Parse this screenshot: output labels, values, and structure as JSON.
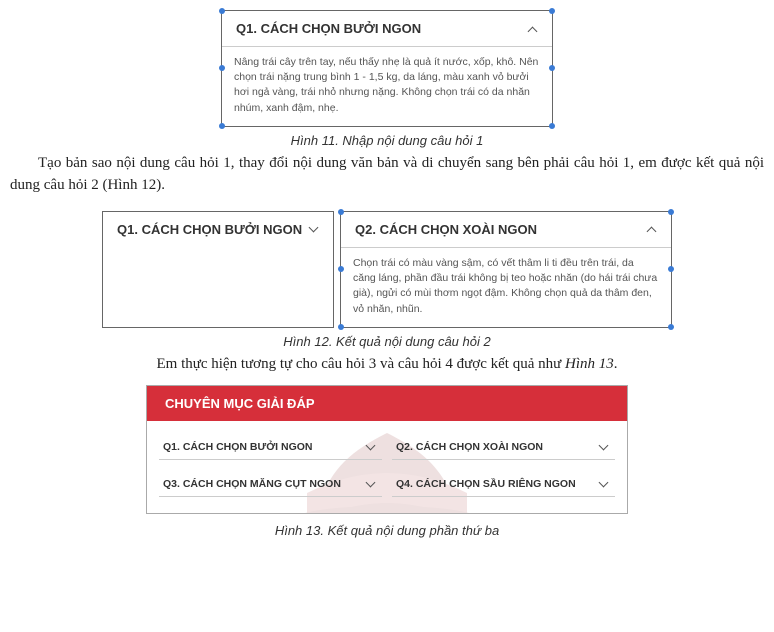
{
  "fig11": {
    "title": "Q1. CÁCH CHỌN BƯỞI NGON",
    "body": "Nâng trái cây trên tay, nếu thấy nhẹ là quả ít nước, xốp, khô. Nên chọn trái nặng trung bình 1 - 1,5 kg, da láng, màu xanh vỏ bưởi hơi ngả vàng, trái nhỏ nhưng nặng. Không chọn trái có da nhăn nhúm, xanh đậm, nhẹ.",
    "caption": "Hình 11. Nhập nội dung câu hỏi 1"
  },
  "para1": "Tạo bản sao nội dung câu hỏi 1, thay đổi nội dung văn bản và di chuyển sang bên phải câu hỏi 1, em được kết quả nội dung câu hỏi 2 (Hình 12).",
  "fig12": {
    "left_title": "Q1. CÁCH CHỌN BƯỞI NGON",
    "right_title": "Q2. CÁCH CHỌN XOÀI NGON",
    "right_body": "Chọn trái có màu vàng sậm, có vết thâm li ti đều trên trái, da căng láng, phần đầu trái không bị teo hoặc nhăn (do hái trái chưa già), ngửi có mùi thơm ngọt đậm. Không chọn quả da thâm đen, vỏ nhăn, nhũn.",
    "caption": "Hình 12. Kết quả nội dung câu hỏi 2"
  },
  "para2_a": "Em thực hiện tương tự cho câu hỏi 3 và câu hỏi 4 được kết quả như ",
  "para2_b": "Hình 13",
  "para2_c": ".",
  "fig13": {
    "header": "CHUYÊN MỤC GIẢI ĐÁP",
    "q1": "Q1. CÁCH CHỌN BƯỞI NGON",
    "q2": "Q2. CÁCH CHỌN XOÀI NGON",
    "q3": "Q3. CÁCH CHỌN MĂNG CỤT NGON",
    "q4": "Q4. CÁCH CHỌN SẦU RIÊNG NGON",
    "caption": "Hình 13. Kết quả nội dung phần thứ ba"
  }
}
